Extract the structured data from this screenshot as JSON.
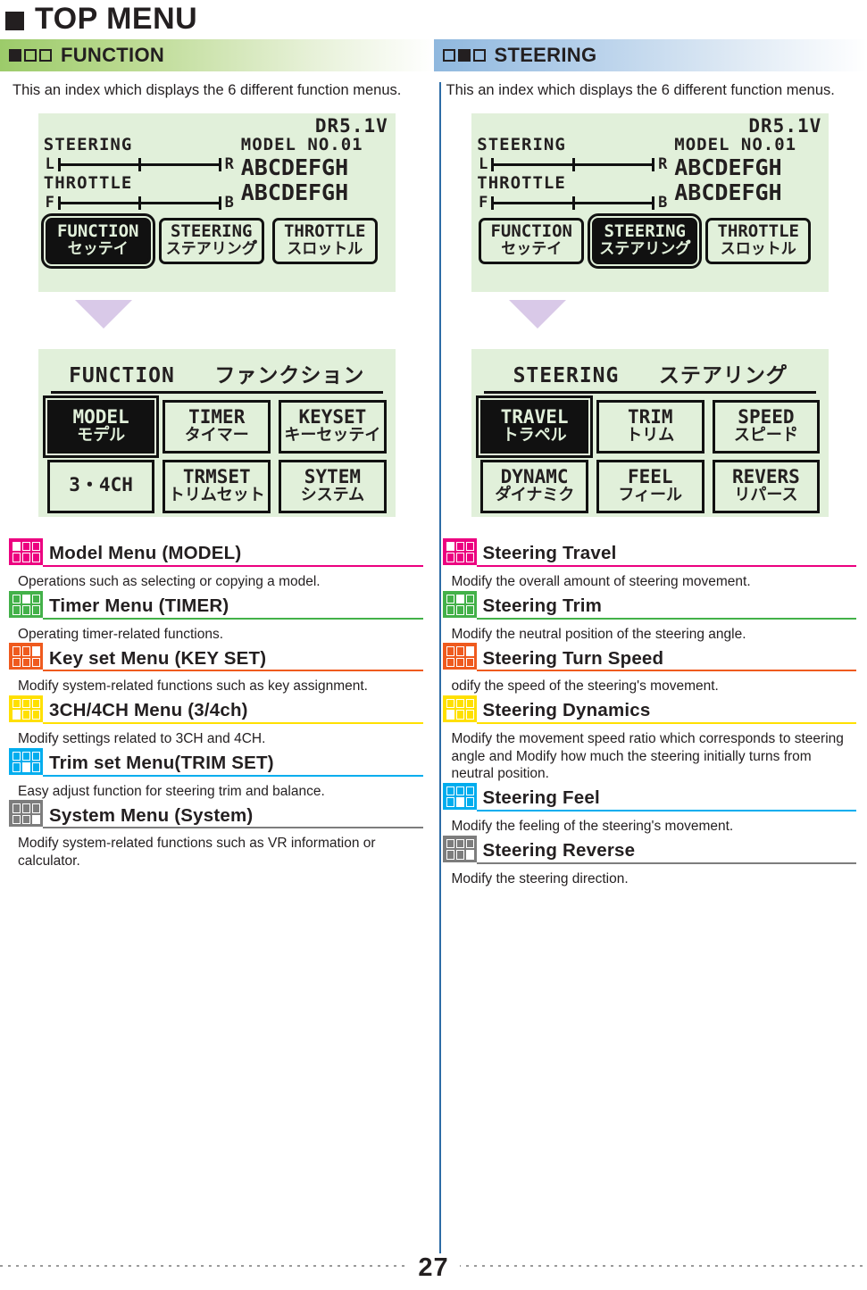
{
  "page": {
    "title": "TOP MENU",
    "number": "27"
  },
  "sections": [
    {
      "id": "function",
      "marks": [
        true,
        false,
        false
      ],
      "heading": "FUNCTION",
      "description": "This an index which displays the 6 different function menus.",
      "accent": "#9ccb6a",
      "lcd_home": {
        "voltage": "DR5.1V",
        "steering_label": "STEERING",
        "steering_left": "L",
        "steering_right": "R",
        "throttle_label": "THROTTLE",
        "throttle_left": "F",
        "throttle_right": "B",
        "model_no": "MODEL NO.01",
        "name1": "ABCDEFGH",
        "name2": "ABCDEFGH",
        "buttons": [
          {
            "en": "FUNCTION",
            "jp": "セッテイ",
            "selected": true
          },
          {
            "en": "STEERING",
            "jp": "ステアリング゚",
            "selected": false
          },
          {
            "en": "THROTTLE",
            "jp": "スロットル",
            "selected": false
          }
        ]
      },
      "lcd_menu": {
        "title_en": "FUNCTION",
        "title_jp": "ファンクション",
        "buttons": [
          {
            "en": "MODEL",
            "jp": "モテ゚ル",
            "selected": true
          },
          {
            "en": "TIMER",
            "jp": "タイマー",
            "selected": false
          },
          {
            "en": "KEYSET",
            "jp": "キーセッテイ",
            "selected": false
          },
          {
            "en": "3・4CH",
            "jp": "",
            "selected": false
          },
          {
            "en": "TRMSET",
            "jp": "トリムセット",
            "selected": false
          },
          {
            "en": "SYTEM",
            "jp": "システム",
            "selected": false
          }
        ]
      },
      "entries": [
        {
          "title": "Model Menu (MODEL)",
          "desc": "Operations such as selecting or copying a model.",
          "color": "#ec0080",
          "fill_index": 0
        },
        {
          "title": "Timer Menu (TIMER)",
          "desc": "Operating timer-related functions.",
          "color": "#43b149",
          "fill_index": 1
        },
        {
          "title": "Key set Menu (KEY SET)",
          "desc": "Modify system-related functions such as key assignment.",
          "color": "#ef5a1e",
          "fill_index": 2
        },
        {
          "title": "3CH/4CH Menu (3/4ch)",
          "desc": "Modify settings related to 3CH and 4CH.",
          "color": "#ffe000",
          "fill_index": 3
        },
        {
          "title": "Trim set Menu(TRIM SET)",
          "desc": "Easy adjust function for steering trim and balance.",
          "color": "#00adee",
          "fill_index": 4
        },
        {
          "title": "System Menu (System)",
          "desc": "Modify system-related functions such as VR information or calculator.",
          "color": "#7d7d7d",
          "fill_index": 5
        }
      ]
    },
    {
      "id": "steering",
      "marks": [
        false,
        true,
        false
      ],
      "heading": "STEERING",
      "description": "This an index which displays the 6 different function menus.",
      "accent": "#8fb8de",
      "lcd_home": {
        "voltage": "DR5.1V",
        "steering_label": "STEERING",
        "steering_left": "L",
        "steering_right": "R",
        "throttle_label": "THROTTLE",
        "throttle_left": "F",
        "throttle_right": "B",
        "model_no": "MODEL NO.01",
        "name1": "ABCDEFGH",
        "name2": "ABCDEFGH",
        "buttons": [
          {
            "en": "FUNCTION",
            "jp": "セッテイ",
            "selected": false
          },
          {
            "en": "STEERING",
            "jp": "ステアリング゚",
            "selected": true
          },
          {
            "en": "THROTTLE",
            "jp": "スロットル",
            "selected": false
          }
        ]
      },
      "lcd_menu": {
        "title_en": "STEERING",
        "title_jp": "ステアリンク゚",
        "buttons": [
          {
            "en": "TRAVEL",
            "jp": "トラペル",
            "selected": true
          },
          {
            "en": "TRIM",
            "jp": "トリム",
            "selected": false
          },
          {
            "en": "SPEED",
            "jp": "スピート゚",
            "selected": false
          },
          {
            "en": "DYNAMC",
            "jp": "タ゚イナミク",
            "selected": false
          },
          {
            "en": "FEEL",
            "jp": "フィール",
            "selected": false
          },
          {
            "en": "REVERS",
            "jp": "リパース",
            "selected": false
          }
        ]
      },
      "entries": [
        {
          "title": "Steering Travel",
          "desc": "Modify the overall amount of steering movement.",
          "color": "#ec0080",
          "fill_index": 0
        },
        {
          "title": "Steering Trim",
          "desc": "Modify the neutral position of the steering angle.",
          "color": "#43b149",
          "fill_index": 1
        },
        {
          "title": "Steering Turn Speed",
          "desc": "odify the speed of the steering's movement.",
          "color": "#ef5a1e",
          "fill_index": 2
        },
        {
          "title": "Steering Dynamics",
          "desc": "Modify the movement speed ratio which corresponds to steering angle and Modify how much the steering initially turns from neutral position.",
          "color": "#ffe000",
          "fill_index": 3
        },
        {
          "title": "Steering Feel",
          "desc": "Modify the feeling of the steering's movement.",
          "color": "#00adee",
          "fill_index": 4
        },
        {
          "title": "Steering Reverse",
          "desc": "Modify the steering direction.",
          "color": "#7d7d7d",
          "fill_index": 5
        }
      ]
    }
  ]
}
